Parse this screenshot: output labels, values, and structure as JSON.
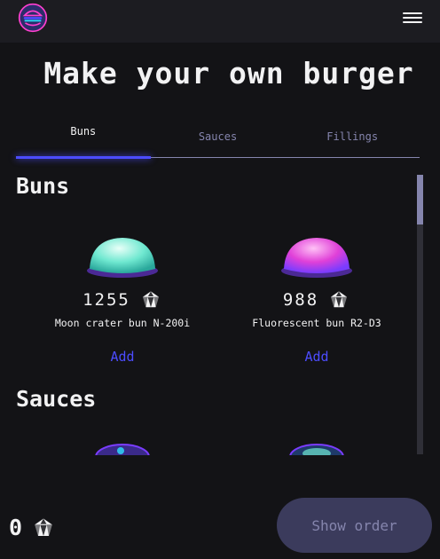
{
  "header": {
    "logo_icon": "burger-logo-icon",
    "menu_icon": "hamburger-menu-icon"
  },
  "page": {
    "title": "Make your own burger"
  },
  "tabs": [
    {
      "label": "Buns",
      "active": true
    },
    {
      "label": "Sauces",
      "active": false
    },
    {
      "label": "Fillings",
      "active": false
    }
  ],
  "sections": {
    "buns": {
      "title": "Buns",
      "items": [
        {
          "price": "1255",
          "name": "Moon crater bun N-200i",
          "add_label": "Add",
          "currency_icon": "crystal-currency-icon"
        },
        {
          "price": "988",
          "name": "Fluorescent bun R2-D3",
          "add_label": "Add",
          "currency_icon": "crystal-currency-icon"
        }
      ]
    },
    "sauces": {
      "title": "Sauces"
    }
  },
  "footer": {
    "total": "0",
    "currency_icon": "crystal-currency-icon",
    "show_order_label": "Show order"
  },
  "colors": {
    "background": "#131316",
    "accent": "#4c4cff",
    "muted": "#8585ad"
  }
}
